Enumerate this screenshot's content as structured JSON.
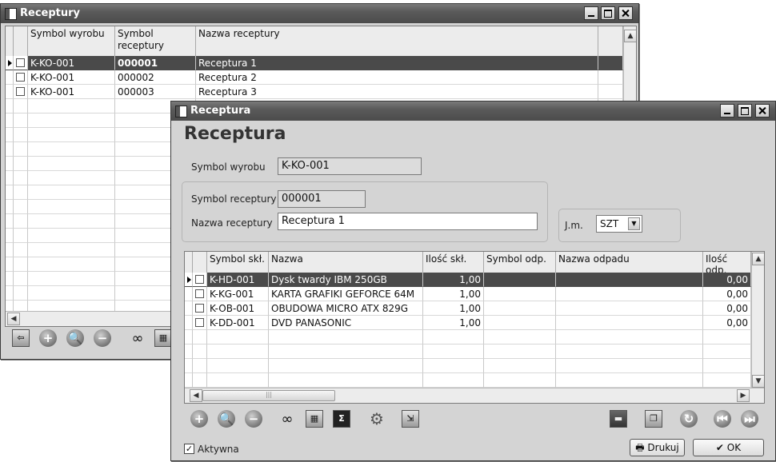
{
  "back_window": {
    "title": "Receptury",
    "columns": [
      "Symbol wyrobu",
      "Symbol\nreceptury",
      "Nazwa receptury"
    ],
    "rows": [
      {
        "symbol_wyrobu": "K-KO-001",
        "symbol_receptury": "000001",
        "nazwa": "Receptura 1",
        "selected": true
      },
      {
        "symbol_wyrobu": "K-KO-001",
        "symbol_receptury": "000002",
        "nazwa": "Receptura 2",
        "selected": false
      },
      {
        "symbol_wyrobu": "K-KO-001",
        "symbol_receptury": "000003",
        "nazwa": "Receptura 3",
        "selected": false
      }
    ],
    "toolbar_icons": [
      "exit-icon",
      "add-icon",
      "view-icon",
      "delete-icon",
      "search-binoculars-icon",
      "filter-grid-icon"
    ]
  },
  "front_window": {
    "title": "Receptura",
    "heading": "Receptura",
    "symbol_wyrobu_label": "Symbol wyrobu",
    "symbol_wyrobu_value": "K-KO-001",
    "symbol_receptury_label": "Symbol receptury",
    "symbol_receptury_value": "000001",
    "nazwa_receptury_label": "Nazwa receptury",
    "nazwa_receptury_value": "Receptura 1",
    "jm_label": "J.m.",
    "jm_value": "SZT",
    "columns": [
      "Symbol skł.",
      "Nazwa",
      "Ilość skł.",
      "Symbol odp.",
      "Nazwa odpadu",
      "Ilość odp."
    ],
    "rows": [
      {
        "symbol": "K-HD-001",
        "nazwa": "Dysk twardy IBM 250GB",
        "ilosc": "1,00",
        "symbol_odp": "",
        "nazwa_odp": "",
        "ilosc_odp": "0,00",
        "selected": true
      },
      {
        "symbol": "K-KG-001",
        "nazwa": "KARTA GRAFIKI GEFORCE 64M",
        "ilosc": "1,00",
        "symbol_odp": "",
        "nazwa_odp": "",
        "ilosc_odp": "0,00",
        "selected": false
      },
      {
        "symbol": "K-OB-001",
        "nazwa": "OBUDOWA MICRO ATX 829G",
        "ilosc": "1,00",
        "symbol_odp": "",
        "nazwa_odp": "",
        "ilosc_odp": "0,00",
        "selected": false
      },
      {
        "symbol": "K-DD-001",
        "nazwa": "DVD PANASONIC",
        "ilosc": "1,00",
        "symbol_odp": "",
        "nazwa_odp": "",
        "ilosc_odp": "0,00",
        "selected": false
      }
    ],
    "aktywna_label": "Aktywna",
    "aktywna_checked": true,
    "drukuj_label": "Drukuj",
    "ok_label": "OK"
  }
}
